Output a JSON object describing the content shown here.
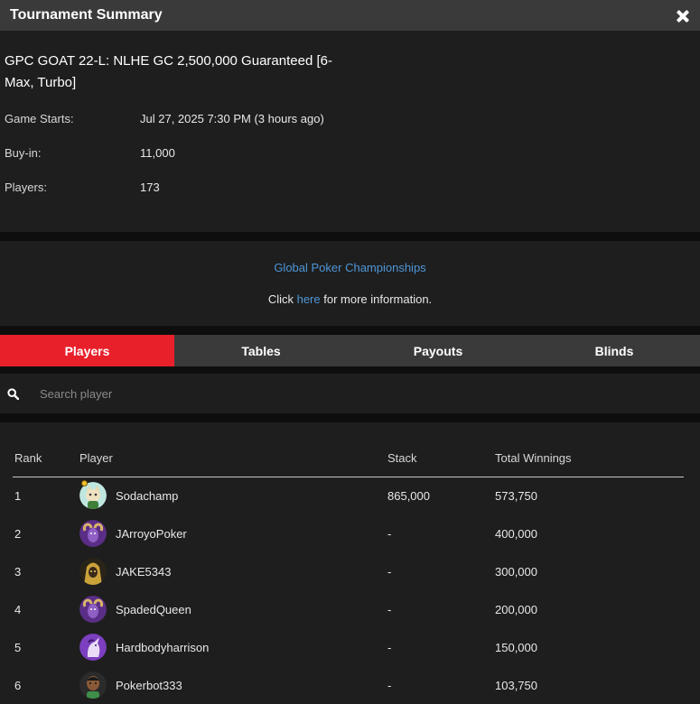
{
  "window": {
    "title": "Tournament Summary",
    "close_icon": "close-icon"
  },
  "tournament": {
    "name": "GPC GOAT 22-L: NLHE GC 2,500,000 Guaranteed [6-Max, Turbo]",
    "details": [
      {
        "label": "Game Starts:",
        "value": "Jul 27, 2025 7:30 PM (3 hours ago)"
      },
      {
        "label": "Buy-in:",
        "value": "11,000"
      },
      {
        "label": "Players:",
        "value": "173"
      }
    ]
  },
  "promo": {
    "name": "Global Poker Championships",
    "prefix": "Click ",
    "link": "here",
    "suffix": " for more information."
  },
  "tabs": [
    {
      "label": "Players",
      "active": true
    },
    {
      "label": "Tables",
      "active": false
    },
    {
      "label": "Payouts",
      "active": false
    },
    {
      "label": "Blinds",
      "active": false
    }
  ],
  "search": {
    "placeholder": "Search player",
    "value": "",
    "icon": "search-icon"
  },
  "table": {
    "headers": {
      "rank": "Rank",
      "player": "Player",
      "stack": "Stack",
      "winnings": "Total Winnings"
    },
    "rows": [
      {
        "rank": "1",
        "player": "Sodachamp",
        "stack": "865,000",
        "winnings": "573,750",
        "avatar": "cat-avatar"
      },
      {
        "rank": "2",
        "player": "JArroyoPoker",
        "stack": "-",
        "winnings": "400,000",
        "avatar": "ram-avatar"
      },
      {
        "rank": "3",
        "player": "JAKE5343",
        "stack": "-",
        "winnings": "300,000",
        "avatar": "hooded-avatar"
      },
      {
        "rank": "4",
        "player": "SpadedQueen",
        "stack": "-",
        "winnings": "200,000",
        "avatar": "ram-avatar"
      },
      {
        "rank": "5",
        "player": "Hardbodyharrison",
        "stack": "-",
        "winnings": "150,000",
        "avatar": "unicorn-avatar"
      },
      {
        "rank": "6",
        "player": "Pokerbot333",
        "stack": "-",
        "winnings": "103,750",
        "avatar": "person-avatar"
      }
    ]
  },
  "colors": {
    "accent": "#e8202a",
    "link": "#4f97d8",
    "panel": "#1e1e1e",
    "header": "#3a3a3a"
  }
}
